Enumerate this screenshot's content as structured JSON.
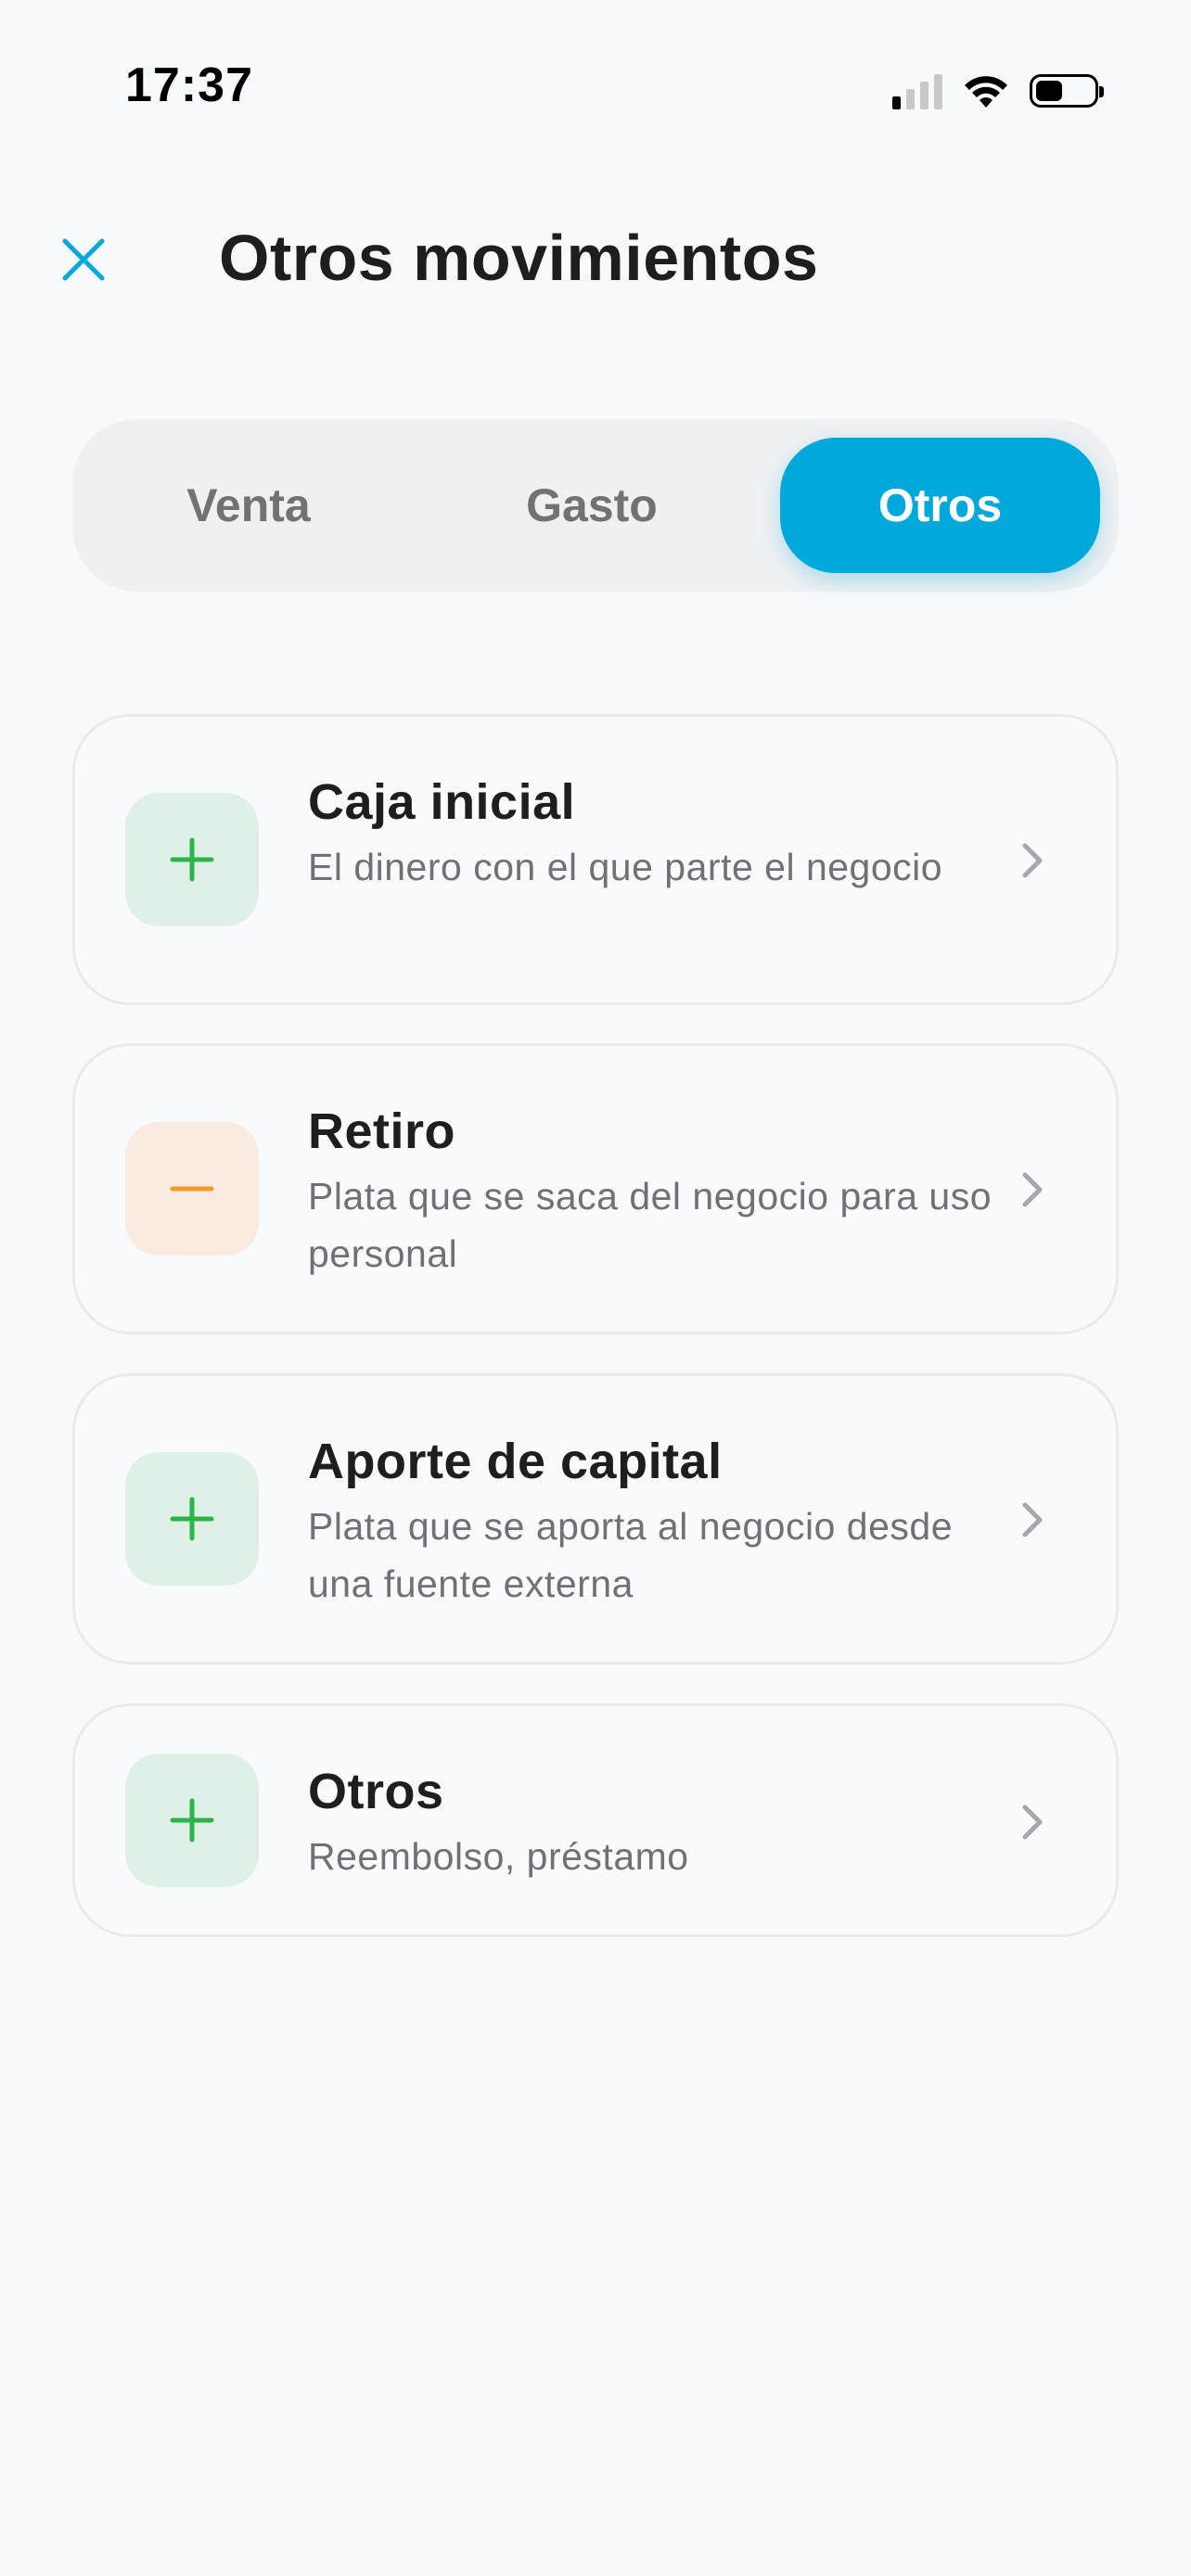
{
  "status_bar": {
    "time": "17:37"
  },
  "header": {
    "title": "Otros movimientos",
    "close_icon": "close-icon"
  },
  "tabs": [
    {
      "label": "Venta",
      "selected": false
    },
    {
      "label": "Gasto",
      "selected": false
    },
    {
      "label": "Otros",
      "selected": true
    }
  ],
  "colors": {
    "accent": "#00A9D9",
    "positive": "#2DB34A",
    "negative": "#F29A2E",
    "positive_bg": "#DFF1E6",
    "negative_bg": "#F9EBDF"
  },
  "options": [
    {
      "title": "Caja inicial",
      "description": "El dinero con el que parte el negocio",
      "icon": "plus-icon"
    },
    {
      "title": "Retiro",
      "description": "Plata que se saca del negocio para uso personal",
      "icon": "minus-icon"
    },
    {
      "title": "Aporte de capital",
      "description": "Plata que se aporta al negocio desde una fuente externa",
      "icon": "plus-icon"
    },
    {
      "title": "Otros",
      "description": "Reembolso, préstamo",
      "icon": "plus-icon"
    }
  ]
}
